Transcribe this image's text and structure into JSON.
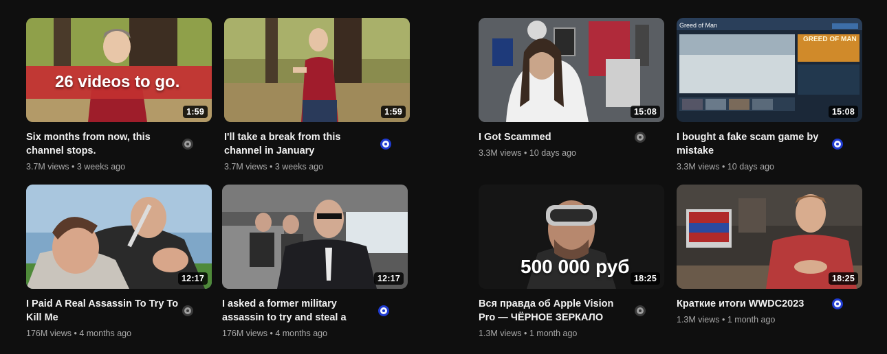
{
  "videos": [
    {
      "title": "Six months from now, this channel stops.",
      "views": "3.7M views",
      "age": "3 weeks ago",
      "duration": "1:59",
      "thumb_text": "26 videos to go.",
      "status": "gray"
    },
    {
      "title": "I'll take a break from this channel in January",
      "views": "3.7M views",
      "age": "3 weeks ago",
      "duration": "1:59",
      "thumb_text": "",
      "status": "blue"
    },
    {
      "title": "I Got Scammed",
      "views": "3.3M views",
      "age": "10 days ago",
      "duration": "15:08",
      "thumb_text": "",
      "status": "gray"
    },
    {
      "title": "I bought a fake scam game by mistake",
      "views": "3.3M views",
      "age": "10 days ago",
      "duration": "15:08",
      "thumb_text": "Greed of Man",
      "thumb_logo": "GREED OF MAN",
      "status": "blue"
    },
    {
      "title": "I Paid A Real Assassin To Try To Kill Me",
      "views": "176M views",
      "age": "4 months ago",
      "duration": "12:17",
      "thumb_text": "",
      "status": "gray"
    },
    {
      "title": "I asked a former military assassin to try and steal a backpack from…",
      "views": "176M views",
      "age": "4 months ago",
      "duration": "12:17",
      "thumb_text": "",
      "status": "blue"
    },
    {
      "title": "Вся правда об Apple Vision Pro — ЧЁРНОЕ ЗЕРКАЛО",
      "views": "1.3M views",
      "age": "1 month ago",
      "duration": "18:25",
      "thumb_text": "500 000 руб",
      "status": "gray"
    },
    {
      "title": "Краткие итоги WWDC2023",
      "views": "1.3M views",
      "age": "1 month ago",
      "duration": "18:25",
      "thumb_text": "",
      "status": "blue"
    }
  ],
  "colors": {
    "background": "#0f0f0f",
    "meta_text": "#aaaaaa",
    "status_blue": "#1f3bd1"
  }
}
